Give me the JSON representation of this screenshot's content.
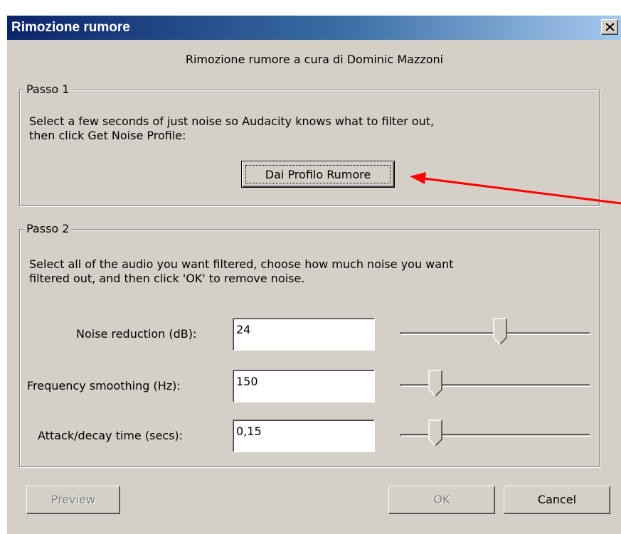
{
  "window": {
    "title": "Rimozione rumore",
    "credit": "Rimozione rumore a cura di Dominic Mazzoni"
  },
  "step1": {
    "legend": "Passo 1",
    "instructions_line1": "Select a few seconds of just noise so Audacity knows what to filter out,",
    "instructions_line2": "then click Get Noise Profile:",
    "button_label": "Dai Profilo Rumore"
  },
  "step2": {
    "legend": "Passo 2",
    "instructions_line1": "Select all of the audio you want filtered, choose how much noise you want",
    "instructions_line2": "filtered out, and then click 'OK' to remove noise.",
    "rows": [
      {
        "label": "Noise reduction (dB):",
        "value": "24",
        "slider_fraction": 0.53
      },
      {
        "label": "Frequency smoothing (Hz):",
        "value": "150",
        "slider_fraction": 0.16
      },
      {
        "label": "Attack/decay time (secs):",
        "value": "0,15",
        "slider_fraction": 0.16
      }
    ]
  },
  "footer": {
    "preview_label": "Preview",
    "ok_label": "OK",
    "cancel_label": "Cancel"
  },
  "colors": {
    "dialog_bg": "#d4d0c8",
    "titlebar_start": "#0a246a",
    "titlebar_end": "#a6caf0",
    "annotation_arrow": "#ff0000"
  },
  "icons": {
    "close": "close-x-icon",
    "arrow": "red-annotation-arrow"
  }
}
